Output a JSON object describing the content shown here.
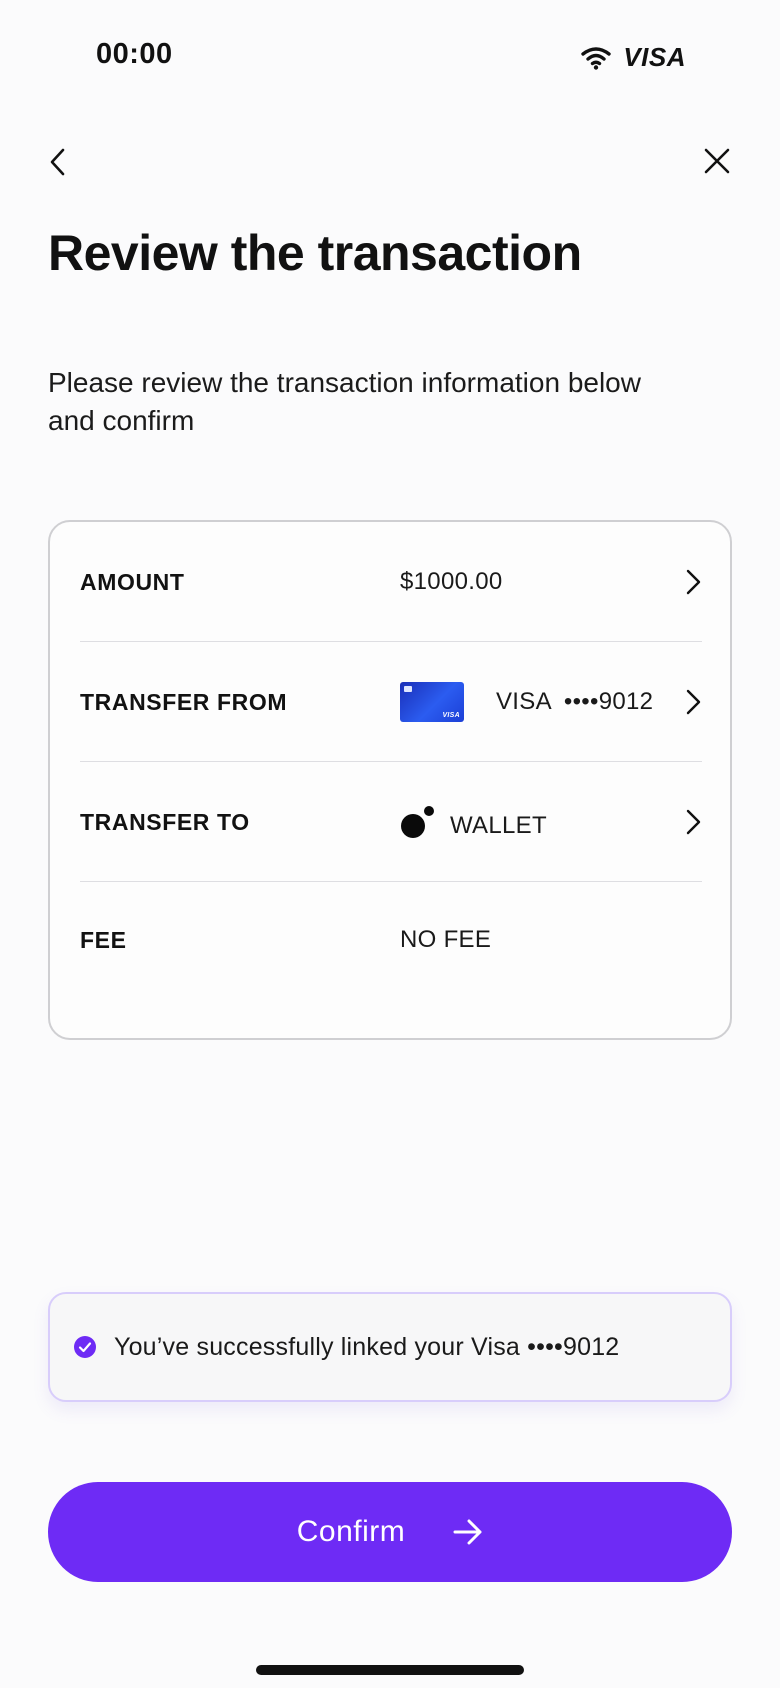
{
  "status_bar": {
    "time": "00:00",
    "brand": "VISA",
    "icons": [
      "wifi-icon"
    ]
  },
  "nav": {
    "back_icon": "chevron-left-icon",
    "close_icon": "close-icon"
  },
  "header": {
    "title": "Review the transaction",
    "subtitle": "Please review the transaction information below and confirm"
  },
  "review": {
    "rows": [
      {
        "label": "AMOUNT",
        "value": "$1000.00",
        "has_chevron": true
      },
      {
        "label": "TRANSFER FROM",
        "card_brand": "VISA",
        "card_mask": "••••9012",
        "card_mini_brand": "VISA",
        "has_chevron": true
      },
      {
        "label": "TRANSFER TO",
        "value": "WALLET",
        "has_chevron": true
      },
      {
        "label": "FEE",
        "value": "NO FEE",
        "has_chevron": false
      }
    ]
  },
  "toast": {
    "message": "You’ve successfully linked your Visa ••••9012",
    "icon": "check-circle-icon"
  },
  "confirm": {
    "label": "Confirm",
    "icon": "arrow-right-icon"
  },
  "colors": {
    "accent": "#6e2bf5",
    "background": "#fbfbfc",
    "card_border": "#cfcfd2",
    "toast_border": "#d8cdfb"
  }
}
